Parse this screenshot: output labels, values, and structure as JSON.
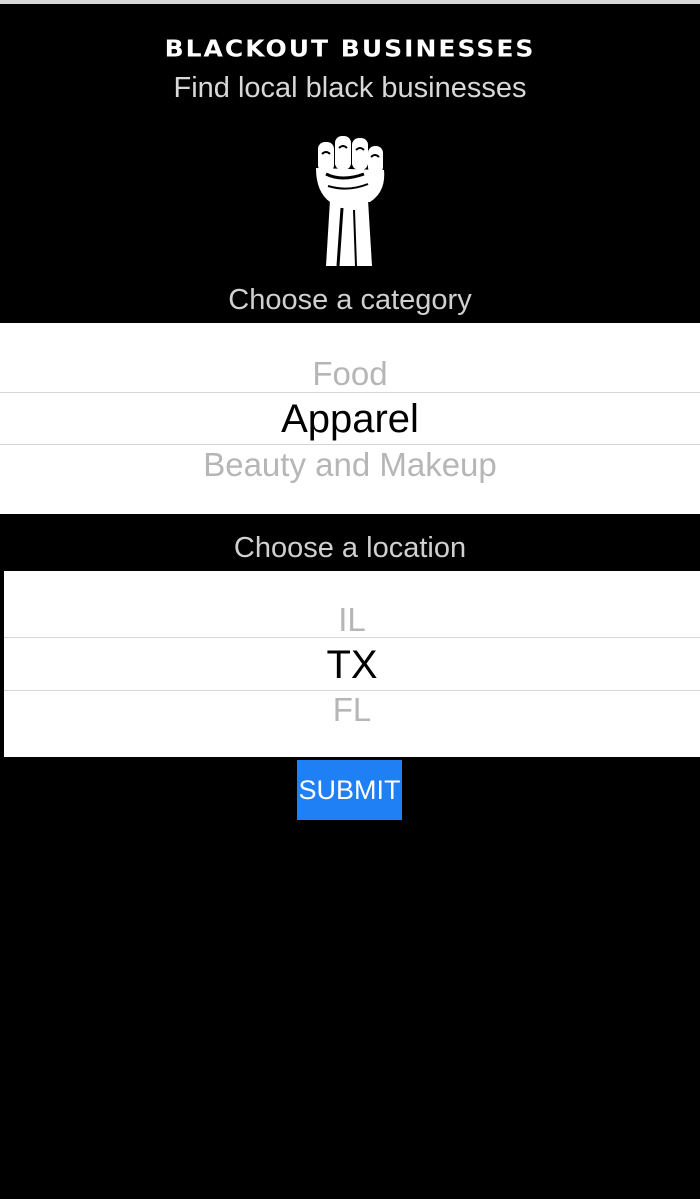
{
  "header": {
    "title": "BLACKOUT BUSINESSES",
    "subtitle": "Find local black businesses",
    "logo_icon": "raised-fist-icon"
  },
  "category": {
    "label": "Choose a category",
    "options_visible": [
      "Food",
      "Apparel",
      "Beauty and Makeup"
    ],
    "above": "Food",
    "selected": "Apparel",
    "below": "Beauty and Makeup"
  },
  "location": {
    "label": "Choose a location",
    "options_visible": [
      "IL",
      "TX",
      "FL"
    ],
    "above": "IL",
    "selected": "TX",
    "below": "FL"
  },
  "submit": {
    "label": "SUBMIT"
  },
  "colors": {
    "background": "#000000",
    "picker_background": "#ffffff",
    "submit_button": "#1f7ff5",
    "faded_option": "#b6b6b6"
  }
}
